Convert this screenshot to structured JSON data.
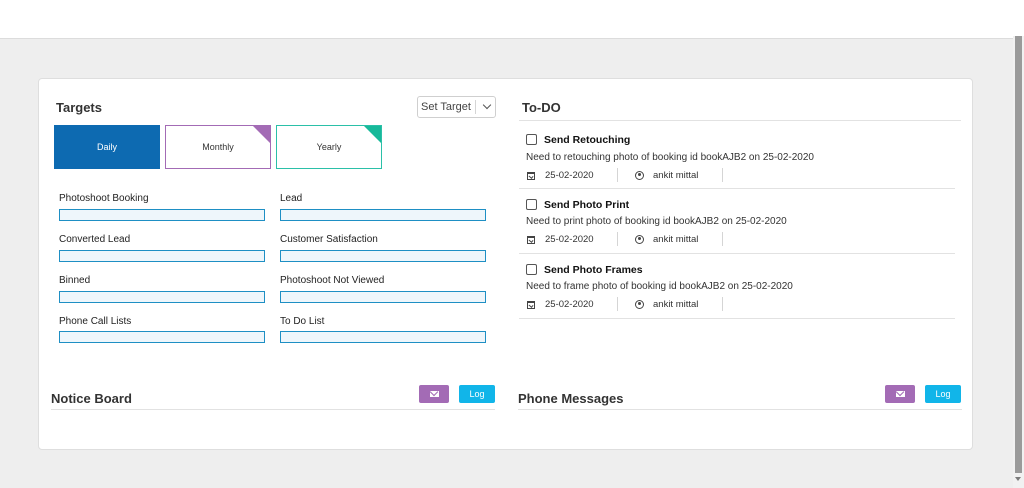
{
  "targets": {
    "title": "Targets",
    "set_target_label": "Set Target",
    "periods": [
      "Daily",
      "Monthly",
      "Yearly"
    ],
    "metrics": [
      {
        "label": "Photoshoot Booking"
      },
      {
        "label": "Lead"
      },
      {
        "label": "Converted Lead"
      },
      {
        "label": "Customer Satisfaction"
      },
      {
        "label": "Binned"
      },
      {
        "label": "Photoshoot Not Viewed"
      },
      {
        "label": "Phone Call Lists"
      },
      {
        "label": "To Do List"
      }
    ]
  },
  "todo": {
    "title": "To-DO",
    "items": [
      {
        "title": "Send Retouching",
        "description": "Need to retouching photo of booking id bookAJB2 on 25-02-2020",
        "date": "25-02-2020",
        "user": "ankit mittal"
      },
      {
        "title": "Send Photo Print",
        "description": "Need to print photo of booking id bookAJB2 on 25-02-2020",
        "date": "25-02-2020",
        "user": "ankit mittal"
      },
      {
        "title": "Send Photo Frames",
        "description": "Need to frame photo of booking id bookAJB2 on 25-02-2020",
        "date": "25-02-2020",
        "user": "ankit mittal"
      }
    ]
  },
  "notice_board": {
    "title": "Notice Board",
    "log_label": "Log"
  },
  "phone_messages": {
    "title": "Phone Messages",
    "log_label": "Log"
  },
  "colors": {
    "daily_tab": "#0d6ab1",
    "monthly_accent": "#a36bb5",
    "yearly_accent": "#17b99a",
    "log_button": "#11b5e9",
    "mail_button": "#a36bb5"
  }
}
